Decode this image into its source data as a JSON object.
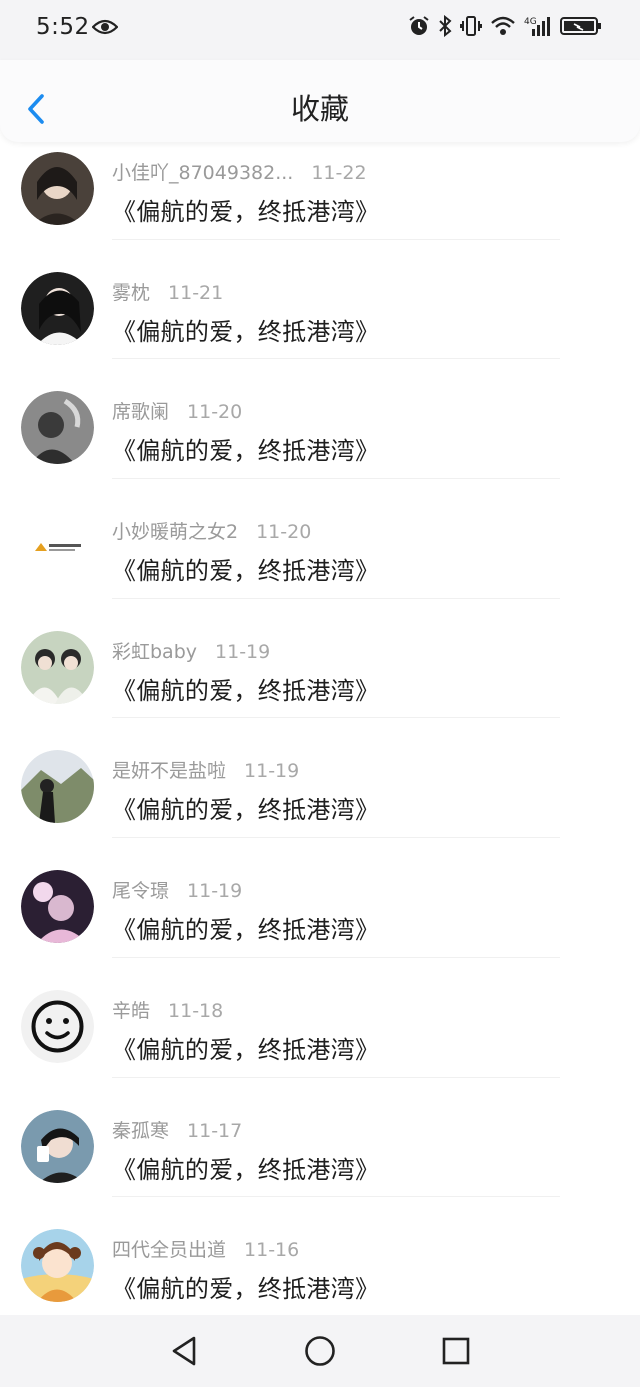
{
  "status": {
    "time": "5:52"
  },
  "header": {
    "title": "收藏"
  },
  "items": [
    {
      "name": "小佳吖_87049382...",
      "date": "11-22",
      "text": "《偏航的爱，终抵港湾》",
      "avatar_color": "#3a3530"
    },
    {
      "name": "雾枕",
      "date": "11-21",
      "text": "《偏航的爱，终抵港湾》",
      "avatar_color": "#2b2b2b"
    },
    {
      "name": "席歌阑",
      "date": "11-20",
      "text": "《偏航的爱，终抵港湾》",
      "avatar_color": "#6e6e6e"
    },
    {
      "name": "小妙暖萌之女2",
      "date": "11-20",
      "text": "《偏航的爱，终抵港湾》",
      "avatar_color": "#ffffff"
    },
    {
      "name": "彩虹baby",
      "date": "11-19",
      "text": "《偏航的爱，终抵港湾》",
      "avatar_color": "#c9d6c0"
    },
    {
      "name": "是妍不是盐啦",
      "date": "11-19",
      "text": "《偏航的爱，终抵港湾》",
      "avatar_color": "#7f8f6a"
    },
    {
      "name": "尾令璟",
      "date": "11-19",
      "text": "《偏航的爱，终抵港湾》",
      "avatar_color": "#3b2a3e"
    },
    {
      "name": "辛皓",
      "date": "11-18",
      "text": "《偏航的爱，终抵港湾》",
      "avatar_color": "#f2f2f2"
    },
    {
      "name": "秦孤寒",
      "date": "11-17",
      "text": "《偏航的爱，终抵港湾》",
      "avatar_color": "#5a7a8a"
    },
    {
      "name": "四代全员出道",
      "date": "11-16",
      "text": "《偏航的爱，终抵港湾》",
      "avatar_color": "#e8b25a"
    }
  ]
}
